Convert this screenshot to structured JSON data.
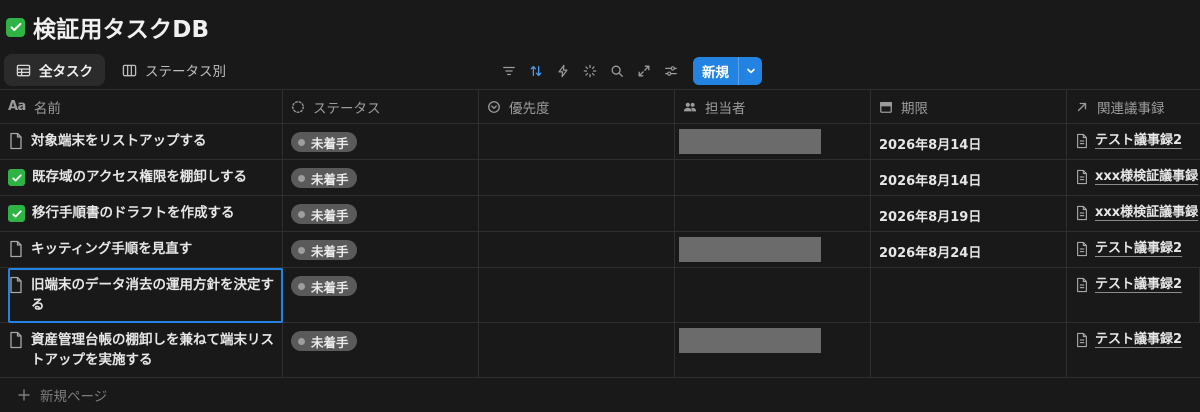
{
  "page": {
    "title": "検証用タスクDB"
  },
  "views": [
    {
      "label": "全タスク",
      "active": true
    },
    {
      "label": "ステータス別",
      "active": false
    }
  ],
  "toolbar": {
    "new_label": "新規"
  },
  "columns": {
    "name": "名前",
    "name_prefix": "Aa",
    "status": "ステータス",
    "priority": "優先度",
    "assignee": "担当者",
    "due": "期限",
    "related": "関連議事録"
  },
  "rows": [
    {
      "icon": "doc",
      "name": "対象端末をリストアップする",
      "status": "未着手",
      "assignee_redacted": true,
      "due": "2026年8月14日",
      "related": "テスト議事録2"
    },
    {
      "icon": "check",
      "name": "既存域のアクセス権限を棚卸しする",
      "status": "未着手",
      "assignee_redacted": false,
      "due": "2026年8月14日",
      "related": "xxx様検証議事録"
    },
    {
      "icon": "check",
      "name": "移行手順書のドラフトを作成する",
      "status": "未着手",
      "assignee_redacted": false,
      "due": "2026年8月19日",
      "related": "xxx様検証議事録"
    },
    {
      "icon": "doc",
      "name": "キッティング手順を見直す",
      "status": "未着手",
      "assignee_redacted": true,
      "due": "2026年8月24日",
      "related": "テスト議事録2"
    },
    {
      "icon": "doc",
      "name": "旧端末のデータ消去の運用方針を決定する",
      "status": "未着手",
      "assignee_redacted": false,
      "due": "",
      "related": "テスト議事録2",
      "selected": true
    },
    {
      "icon": "doc",
      "name": "資産管理台帳の棚卸しを兼ねて端末リストアップを実施する",
      "status": "未着手",
      "assignee_redacted": true,
      "due": "",
      "related": "テスト議事録2"
    }
  ],
  "footer": {
    "new_page_label": "新規ページ"
  },
  "colors": {
    "accent": "#2383e2",
    "check": "#2fb344",
    "status_pill": "#5a5a5a",
    "background": "#191919"
  }
}
